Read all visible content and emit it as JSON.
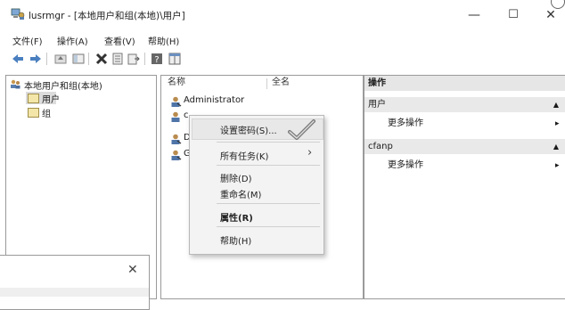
{
  "window": {
    "title": "lusrmgr - [本地用户和组(本地)\\用户]",
    "minimize": "—",
    "maximize": "☐",
    "close": "✕"
  },
  "menu": [
    "文件(F)",
    "操作(A)",
    "查看(V)",
    "帮助(H)"
  ],
  "toolbar": {
    "icons": [
      "back-arrow-icon",
      "forward-arrow-icon",
      "up-folder-icon",
      "show-hide-tree-icon",
      "delete-icon",
      "properties-icon",
      "export-icon",
      "help-icon",
      "mmc-view-icon"
    ]
  },
  "tree": {
    "root": "本地用户和组(本地)",
    "items": [
      "用户",
      "组"
    ]
  },
  "list": {
    "columns": [
      "名称",
      "全名"
    ],
    "rows": [
      "Administrator",
      "c",
      "D",
      "G"
    ]
  },
  "actions": {
    "header": "操作",
    "sections": [
      {
        "title": "用户",
        "item": "更多操作"
      },
      {
        "title": "cfanp",
        "item": "更多操作"
      }
    ]
  },
  "context_menu": {
    "items": [
      "设置密码(S)...",
      "所有任务(K)",
      "删除(D)",
      "重命名(M)",
      "属性(R)",
      "帮助(H)"
    ],
    "submenu_arrow": "›"
  },
  "dialog": {
    "close": "✕"
  },
  "colors": {
    "highlight_row": "#e8e8e8",
    "action_header": "#e6e6e6",
    "selected_tree": "#dcdcdc"
  }
}
